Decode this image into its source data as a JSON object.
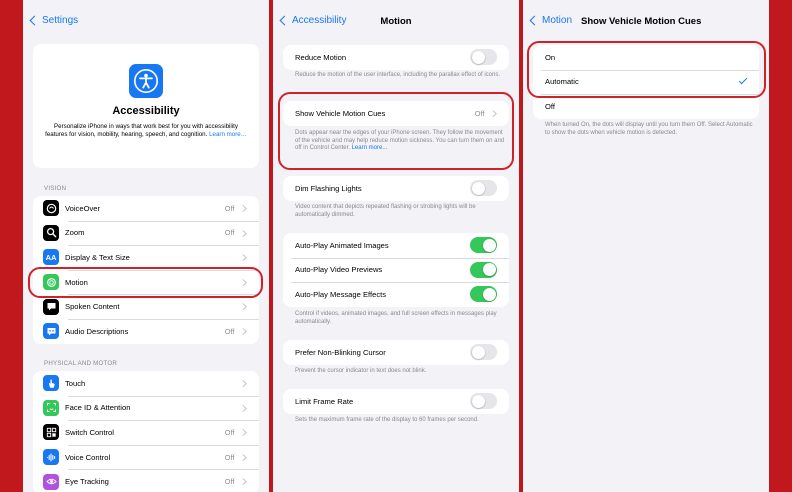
{
  "colors": {
    "accent": "#1878f3",
    "toggle_on": "#34c759",
    "highlight": "#d0222a",
    "background": "#c0181d"
  },
  "panel1": {
    "back_label": "Settings",
    "card": {
      "title": "Accessibility",
      "description": "Personalize iPhone in ways that work best for you with accessibility features for vision, mobility, hearing, speech, and cognition.",
      "link": "Learn more…"
    },
    "vision_header": "VISION",
    "vision_items": [
      {
        "label": "VoiceOver",
        "value": "Off",
        "icon": "voiceover-icon",
        "color": "#000000"
      },
      {
        "label": "Zoom",
        "value": "Off",
        "icon": "zoom-icon",
        "color": "#000000"
      },
      {
        "label": "Display & Text Size",
        "value": "",
        "icon": "text-size-icon",
        "color": "#1878f3"
      },
      {
        "label": "Motion",
        "value": "",
        "icon": "motion-icon",
        "color": "#34c759"
      },
      {
        "label": "Spoken Content",
        "value": "",
        "icon": "speech-bubble-icon",
        "color": "#000000"
      },
      {
        "label": "Audio Descriptions",
        "value": "Off",
        "icon": "audio-description-icon",
        "color": "#1878f3"
      }
    ],
    "motor_header": "PHYSICAL AND MOTOR",
    "motor_items": [
      {
        "label": "Touch",
        "value": "",
        "icon": "hand-icon",
        "color": "#1878f3"
      },
      {
        "label": "Face ID & Attention",
        "value": "",
        "icon": "face-id-icon",
        "color": "#34c759"
      },
      {
        "label": "Switch Control",
        "value": "Off",
        "icon": "switch-control-icon",
        "color": "#000000"
      },
      {
        "label": "Voice Control",
        "value": "Off",
        "icon": "voice-control-icon",
        "color": "#1878f3"
      },
      {
        "label": "Eye Tracking",
        "value": "Off",
        "icon": "eye-tracking-icon",
        "color": "#af52de"
      }
    ]
  },
  "panel2": {
    "back_label": "Accessibility",
    "title": "Motion",
    "reduce_motion": {
      "label": "Reduce Motion",
      "on": false,
      "footer": "Reduce the motion of the user interface, including the parallax effect of icons."
    },
    "vehicle_cues": {
      "label": "Show Vehicle Motion Cues",
      "value": "Off",
      "footer": "Dots appear near the edges of your iPhone screen. They follow the movement of the vehicle and may help reduce motion sickness. You can turn them on and off in Control Center.",
      "link": "Learn more..."
    },
    "dim_flashing": {
      "label": "Dim Flashing Lights",
      "on": false,
      "footer": "Video content that depicts repeated flashing or strobing lights will be automatically dimmed."
    },
    "autoplay": [
      {
        "label": "Auto-Play Animated Images",
        "on": true
      },
      {
        "label": "Auto-Play Video Previews",
        "on": true
      },
      {
        "label": "Auto-Play Message Effects",
        "on": true
      }
    ],
    "autoplay_footer": "Control if videos, animated images, and full screen effects in messages play automatically.",
    "cursor": {
      "label": "Prefer Non-Blinking Cursor",
      "on": false,
      "footer": "Prevent the cursor indicator in text does not blink."
    },
    "frame_rate": {
      "label": "Limit Frame Rate",
      "on": false,
      "footer": "Sets the maximum frame rate of the display to 60 frames per second."
    }
  },
  "panel3": {
    "back_label": "Motion",
    "title": "Show Vehicle Motion Cues",
    "options": [
      {
        "label": "On",
        "selected": false
      },
      {
        "label": "Automatic",
        "selected": true
      },
      {
        "label": "Off",
        "selected": false
      }
    ],
    "footer": "When turned On, the dots will display until you turn them Off. Select Automatic to show the dots when vehicle motion is detected."
  }
}
